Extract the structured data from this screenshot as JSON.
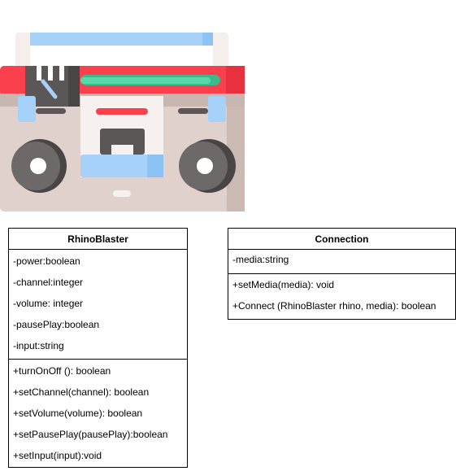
{
  "colors": {
    "red": "#FA3F4D",
    "beige": "#E0D1CC",
    "dark_gray": "#5B5757",
    "blue": "#A6D1F8",
    "green": "#4FD1A0"
  },
  "illustration": {
    "name": "boombox-icon"
  },
  "classes": [
    {
      "title": "RhinoBlaster",
      "attributes": [
        "-power:boolean",
        "-channel:integer",
        "-volume: integer",
        "-pausePlay:boolean",
        "-input:string"
      ],
      "operations": [
        "+turnOnOff (): boolean",
        "+setChannel(channel): boolean",
        "+setVolume(volume): boolean",
        "+setPausePlay(pausePlay):boolean",
        "+setInput(input):void"
      ]
    },
    {
      "title": "Connection",
      "attributes": [
        "-media:string"
      ],
      "operations": [
        "+setMedia(media): void",
        "+Connect (RhinoBlaster rhino, media): boolean"
      ]
    }
  ]
}
